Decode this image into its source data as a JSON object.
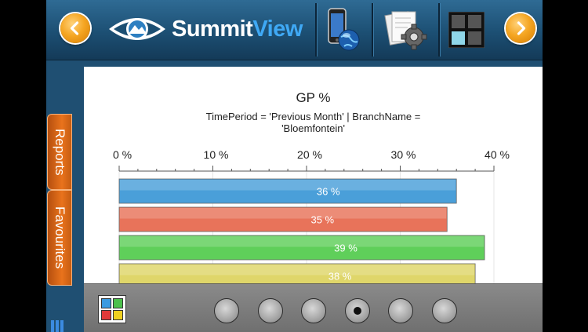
{
  "app": {
    "logo_part1": "Summit",
    "logo_part2": "View"
  },
  "toolbar": {
    "items": [
      "mobile-globe-icon",
      "settings-document-icon",
      "layout-grid-icon"
    ]
  },
  "side_tabs": {
    "reports": "Reports",
    "favourites": "Favourites"
  },
  "chart_data": {
    "type": "bar",
    "title": "GP %",
    "subtitle": "TimePeriod = 'Previous Month' | BranchName = 'Bloemfontein'",
    "xlim": [
      0,
      40
    ],
    "tick_values": [
      0,
      10,
      20,
      30,
      40
    ],
    "tick_labels": [
      "0 %",
      "10 %",
      "20 %",
      "30 %",
      "40 %"
    ],
    "values": [
      36,
      35,
      39,
      38
    ],
    "data_labels": [
      "36 %",
      "35 %",
      "39 %",
      "38 %"
    ],
    "colors": [
      "#4a9fd9",
      "#e8735a",
      "#5fcf5a",
      "#dfd66a"
    ],
    "grid": true
  },
  "pager": {
    "pages": 6,
    "active_index": 3
  },
  "colors": {
    "accent": "#f5a623",
    "toolbar": "#1c4f73",
    "tab": "#e9731c"
  }
}
